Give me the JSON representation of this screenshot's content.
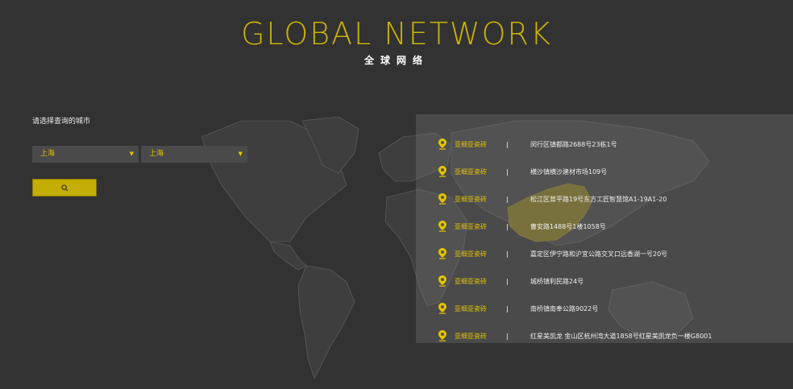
{
  "header": {
    "title": "GLOBAL NETWORK",
    "subtitle": "全球网络"
  },
  "filter": {
    "prompt": "请选择查询的城市",
    "province_select": "上海",
    "city_select": "上海"
  },
  "icons": {
    "search": "search-icon",
    "pin": "location-pin-icon",
    "caret": "caret-down-icon"
  },
  "colors": {
    "accent": "#c9b307",
    "background": "#323232",
    "panel": "#5a5a5a"
  },
  "stores": [
    {
      "brand": "亚细亚瓷砖",
      "address": "闵行区镇都路2688号23栋1号"
    },
    {
      "brand": "亚细亚瓷砖",
      "address": "横沙镇横沙建材市场109号"
    },
    {
      "brand": "亚细亚瓷砖",
      "address": "松江区茸平路19号东方工匠智慧馆A1-19A1-20"
    },
    {
      "brand": "亚细亚瓷砖",
      "address": "曹安路1488号1楼1058号"
    },
    {
      "brand": "亚细亚瓷砖",
      "address": "嘉定区伊宁路和沪宜公路交叉口远香湖一号20号"
    },
    {
      "brand": "亚细亚瓷砖",
      "address": "城桥镇利民路24号"
    },
    {
      "brand": "亚细亚瓷砖",
      "address": "南桥镇南奉公路9022号"
    },
    {
      "brand": "亚细亚瓷砖",
      "address": "红星美凯龙 金山区杭州湾大道1858号红星美凯龙负一楼G8001"
    }
  ]
}
